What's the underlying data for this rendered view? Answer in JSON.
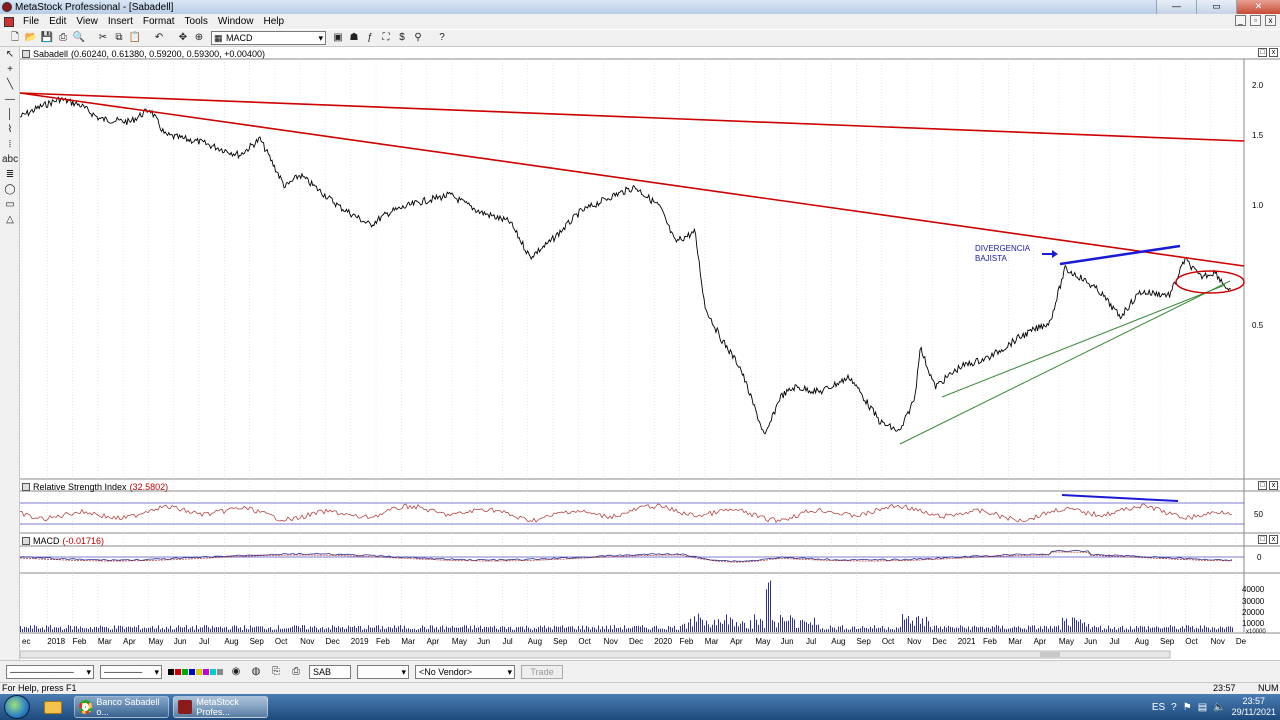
{
  "window": {
    "title": "MetaStock Professional - [Sabadell]",
    "buttons": {
      "minimize": "—",
      "maximize": "▭",
      "close": "✕"
    }
  },
  "menu": [
    "File",
    "Edit",
    "View",
    "Insert",
    "Format",
    "Tools",
    "Window",
    "Help"
  ],
  "toolbar": {
    "indicator_select": "MACD"
  },
  "price_pane": {
    "header_label": "Sabadell",
    "header_values": "(0.60240, 0.61380, 0.59200, 0.59300, +0.00400)",
    "annotation_line1": "DIVERGENCIA",
    "annotation_line2": "BAJISTA",
    "y_ticks": [
      "2.0",
      "1.5",
      "1.0",
      "0.5"
    ]
  },
  "rsi_pane": {
    "header_label": "Relative Strength Index",
    "header_value": "(32.5802)",
    "y_tick": "50"
  },
  "macd_pane": {
    "header_label": "MACD",
    "header_value": "(-0.01716)",
    "y_tick": "0"
  },
  "volume_pane": {
    "y_ticks": [
      "40000",
      "30000",
      "20000",
      "10000"
    ],
    "y_unit": "x10000"
  },
  "time_axis": [
    "ec",
    "2018",
    "Feb",
    "Mar",
    "Apr",
    "May",
    "Jun",
    "Jul",
    "Aug",
    "Sep",
    "Oct",
    "Nov",
    "Dec",
    "2019",
    "Feb",
    "Mar",
    "Apr",
    "May",
    "Jun",
    "Jul",
    "Aug",
    "Sep",
    "Oct",
    "Nov",
    "Dec",
    "2020",
    "Feb",
    "Mar",
    "Apr",
    "May",
    "Jun",
    "Jul",
    "Aug",
    "Sep",
    "Oct",
    "Nov",
    "Dec",
    "2021",
    "Feb",
    "Mar",
    "Apr",
    "May",
    "Jun",
    "Jul",
    "Aug",
    "Sep",
    "Oct",
    "Nov",
    "De"
  ],
  "bottom_bar": {
    "symbol": "SAB",
    "vendor": "<No Vendor>",
    "trade": "Trade"
  },
  "status": {
    "help": "For Help, press F1",
    "time": "23:57",
    "num": "NUM"
  },
  "taskbar": {
    "task1": "Banco Sabadell o...",
    "task2": "MetaStock Profes...",
    "clock_time": "23:57",
    "clock_date": "29/11/2021"
  },
  "colors": {
    "price_line": "#000000",
    "trendline_red": "#cc0000",
    "divergence_blue": "#1a1ad6",
    "support_green": "#3a8a3a",
    "rsi_line": "#b03030",
    "volume_bars": "#3030a0",
    "annotation_text": "#1a1aa8"
  },
  "icons": {
    "new": "file-new-icon",
    "open": "folder-open-icon",
    "save": "save-icon",
    "print": "print-icon",
    "cut": "cut-icon",
    "copy": "copy-icon",
    "paste": "paste-icon",
    "undo": "undo-icon",
    "pan": "pan-icon",
    "zoom": "zoom-icon",
    "help": "help-arrow-icon"
  }
}
